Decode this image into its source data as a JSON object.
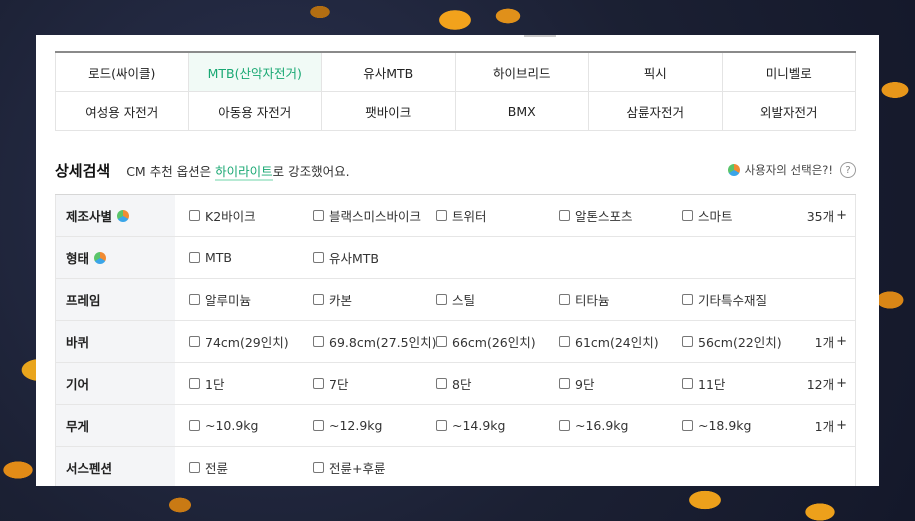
{
  "categories": [
    {
      "label": "로드(싸이클)",
      "active": false
    },
    {
      "label": "MTB(산악자전거)",
      "active": true
    },
    {
      "label": "유사MTB",
      "active": false
    },
    {
      "label": "하이브리드",
      "active": false
    },
    {
      "label": "픽시",
      "active": false
    },
    {
      "label": "미니벨로",
      "active": false
    },
    {
      "label": "여성용 자전거",
      "active": false
    },
    {
      "label": "아동용 자전거",
      "active": false
    },
    {
      "label": "팻바이크",
      "active": false
    },
    {
      "label": "BMX",
      "active": false
    },
    {
      "label": "삼륜자전거",
      "active": false
    },
    {
      "label": "외발자전거",
      "active": false
    }
  ],
  "search": {
    "title": "상세검색",
    "desc_prefix": "CM 추천 옵션은 ",
    "desc_highlight": "하이라이트",
    "desc_suffix": "로 강조했어요.",
    "user_choice_label": "사용자의 선택은?!",
    "help_symbol": "?"
  },
  "filters": [
    {
      "label": "제조사별",
      "has_pie": true,
      "options": [
        "K2바이크",
        "블랙스미스바이크",
        "트위터",
        "알톤스포츠",
        "스마트"
      ],
      "more": "35개"
    },
    {
      "label": "형태",
      "has_pie": true,
      "options": [
        "MTB",
        "유사MTB"
      ],
      "more": ""
    },
    {
      "label": "프레임",
      "has_pie": false,
      "options": [
        "알루미늄",
        "카본",
        "스틸",
        "티타늄",
        "기타특수재질"
      ],
      "more": ""
    },
    {
      "label": "바퀴",
      "has_pie": false,
      "options": [
        "74cm(29인치)",
        "69.8cm(27.5인치)",
        "66cm(26인치)",
        "61cm(24인치)",
        "56cm(22인치)"
      ],
      "more": "1개"
    },
    {
      "label": "기어",
      "has_pie": false,
      "options": [
        "1단",
        "7단",
        "8단",
        "9단",
        "11단"
      ],
      "more": "12개"
    },
    {
      "label": "무게",
      "has_pie": false,
      "options": [
        "~10.9kg",
        "~12.9kg",
        "~14.9kg",
        "~16.9kg",
        "~18.9kg"
      ],
      "more": "1개"
    },
    {
      "label": "서스펜션",
      "has_pie": false,
      "options": [
        "전륜",
        "전륜+후륜"
      ],
      "more": ""
    }
  ],
  "more_plus": "+",
  "colors": {
    "accent": "#19a873",
    "label_bg": "#f4f5f7"
  }
}
